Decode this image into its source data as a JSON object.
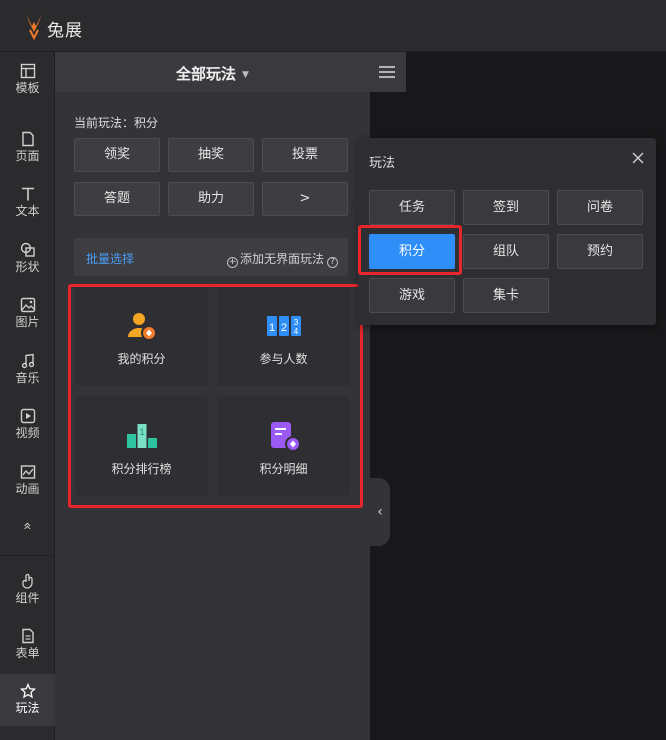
{
  "app": {
    "brand": "兔展"
  },
  "sidebar": {
    "items": [
      {
        "label": "模板",
        "icon": "template-icon"
      },
      {
        "label": "页面",
        "icon": "page-icon"
      },
      {
        "label": "文本",
        "icon": "text-icon"
      },
      {
        "label": "形状",
        "icon": "shape-icon"
      },
      {
        "label": "图片",
        "icon": "image-icon"
      },
      {
        "label": "音乐",
        "icon": "music-icon"
      },
      {
        "label": "视频",
        "icon": "video-icon"
      },
      {
        "label": "动画",
        "icon": "animation-icon"
      },
      {
        "label": "组件",
        "icon": "component-icon"
      },
      {
        "label": "表单",
        "icon": "form-icon"
      },
      {
        "label": "玩法",
        "icon": "gameplay-icon"
      }
    ],
    "collapse_glyph": "»",
    "active": "玩法"
  },
  "panel": {
    "title": "全部玩法",
    "current_label": "当前玩法：积分",
    "categories": [
      "领奖",
      "抽奖",
      "投票",
      "答题",
      "助力",
      ">"
    ],
    "batch_select": "批量选择",
    "add_nonui": "添加无界面玩法",
    "cards": [
      {
        "label": "我的积分",
        "icon": "user-points-icon"
      },
      {
        "label": "参与人数",
        "icon": "counter-icon"
      },
      {
        "label": "积分排行榜",
        "icon": "leaderboard-icon"
      },
      {
        "label": "积分明细",
        "icon": "points-detail-icon"
      }
    ]
  },
  "popup": {
    "title": "玩法",
    "options": [
      "任务",
      "签到",
      "问卷",
      "积分",
      "组队",
      "预约",
      "游戏",
      "集卡"
    ],
    "selected": "积分"
  },
  "colors": {
    "accent": "#2f8ef8",
    "highlight": "#e8262b",
    "link": "#4a9cf5",
    "brand_orange": "#f07a2a"
  }
}
